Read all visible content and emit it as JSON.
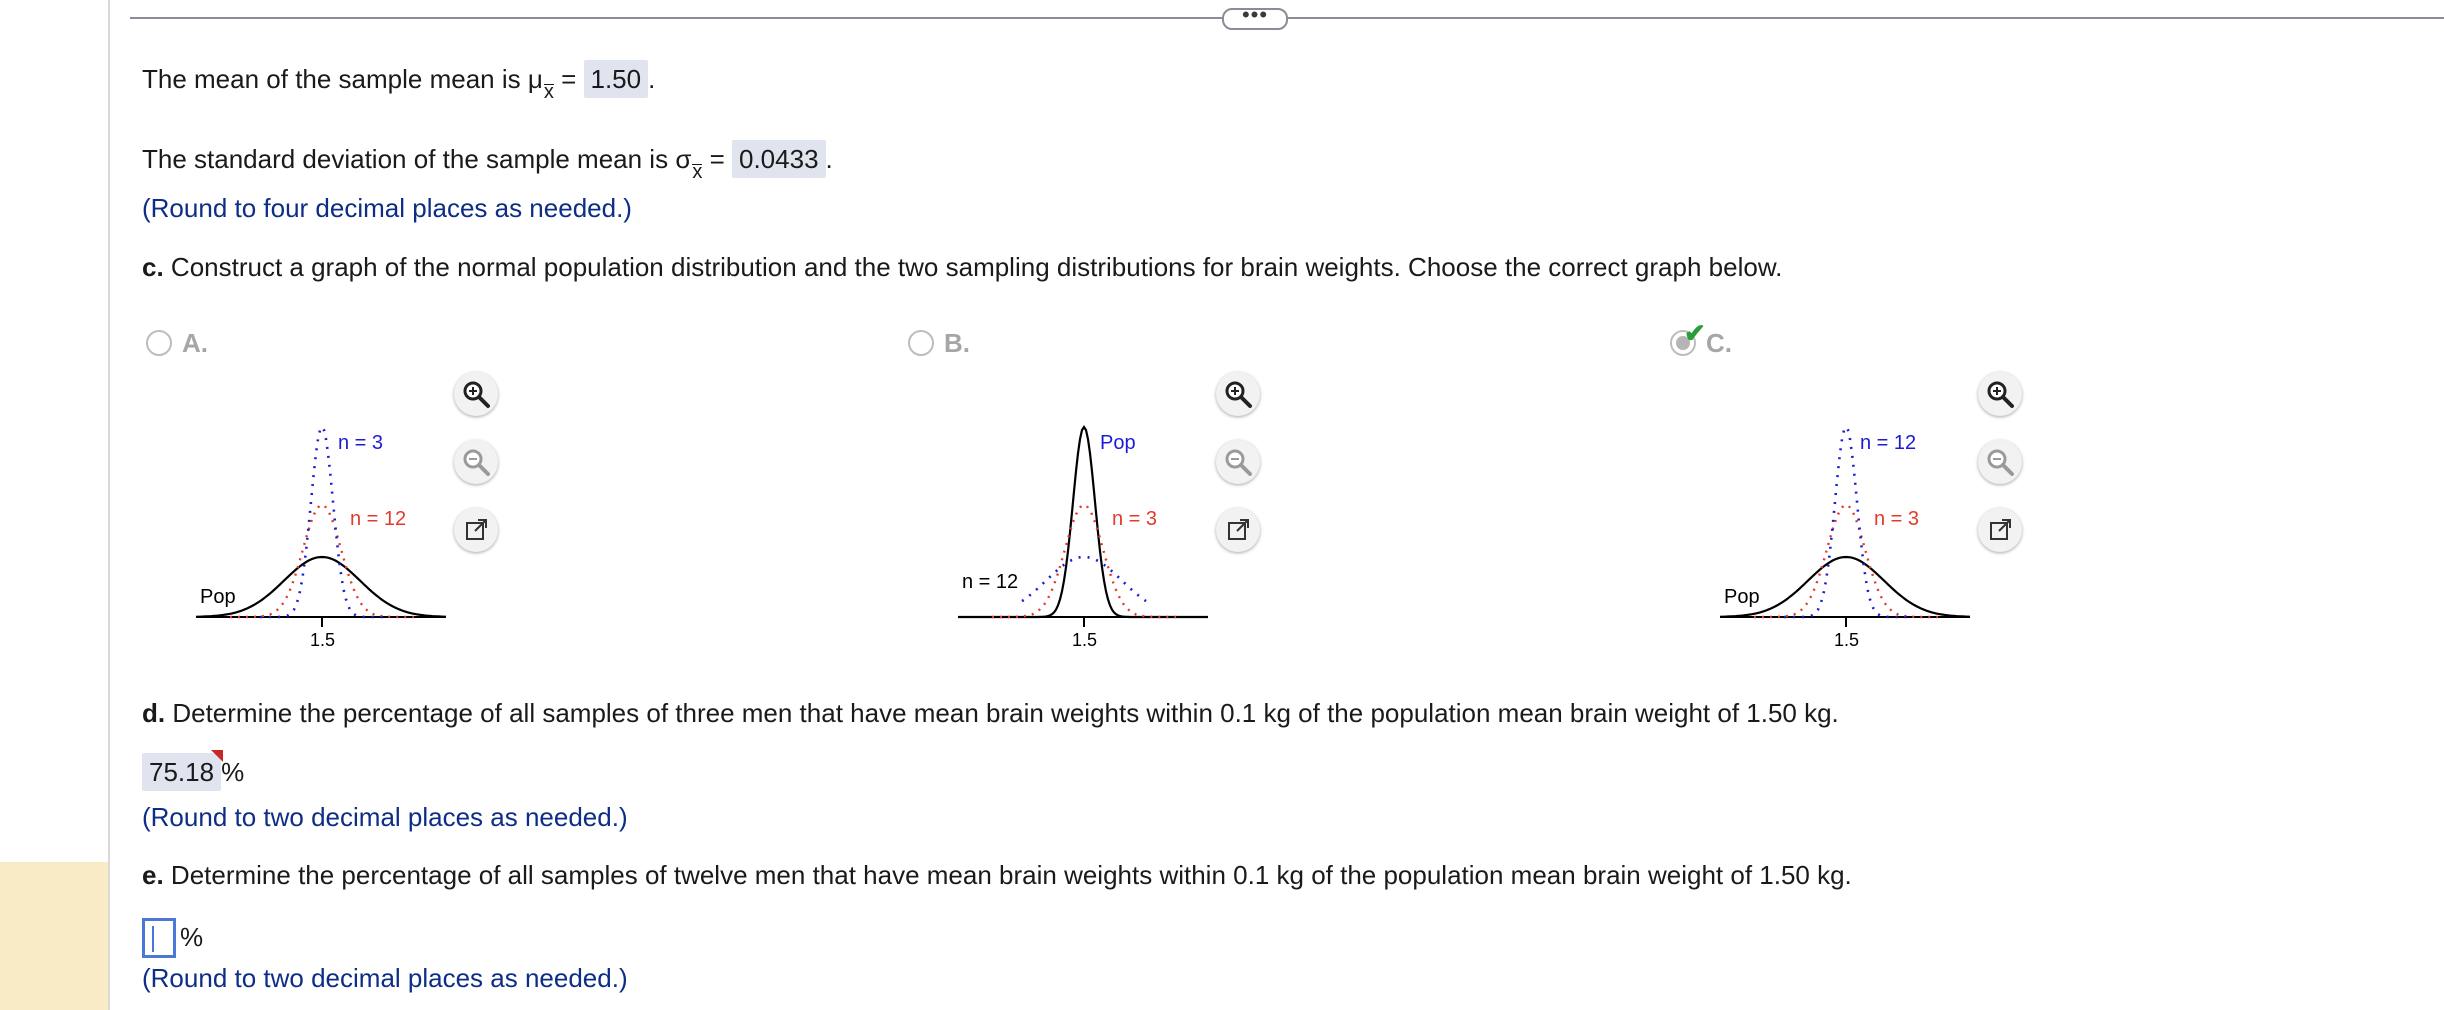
{
  "q_mean": {
    "prefix": "The mean of the sample mean is ",
    "mu": "μ",
    "sub": "x",
    "eq": " = ",
    "value": "1.50",
    "end": "."
  },
  "q_sd": {
    "prefix": "The standard deviation of the sample mean is ",
    "sigma": "σ",
    "sub": "x",
    "eq": " = ",
    "value": "0.0433",
    "end": "."
  },
  "hint_four": "(Round to four decimal places as needed.)",
  "part_c": {
    "label": "c.",
    "text": " Construct a graph of the normal population distribution and the two sampling distributions for brain weights. Choose the correct graph below."
  },
  "options": [
    {
      "label": "A.",
      "selected": false,
      "tall": "n = 3",
      "mid": "n = 12",
      "wide": "Pop",
      "tick": "1.5"
    },
    {
      "label": "B.",
      "selected": false,
      "tall": "Pop",
      "mid": "n = 3",
      "wide": "n = 12",
      "tick": "1.5"
    },
    {
      "label": "C.",
      "selected": true,
      "tall": "n = 12",
      "mid": "n = 3",
      "wide": "Pop",
      "tick": "1.5"
    }
  ],
  "colors": {
    "tall_curve": "#1c1cd4",
    "mid_curve": "#e23a2c",
    "wide_curve": "#000000",
    "hint": "#0d2d86",
    "answer_bg": "#dfe4ee"
  },
  "icons": [
    "zoom-in-icon",
    "zoom-out-icon",
    "popout-icon"
  ],
  "part_d": {
    "label": "d.",
    "text": " Determine the percentage of all samples of three men that have mean brain weights within 0.1 kg of the population mean brain weight of 1.50 kg."
  },
  "answer_d": {
    "value": "75.18",
    "unit": "%"
  },
  "hint_two": "(Round to two decimal places as needed.)",
  "part_e": {
    "label": "e.",
    "text": " Determine the percentage of all samples of twelve men that have mean brain weights within 0.1 kg of the population mean brain weight of 1.50 kg."
  },
  "answer_e": {
    "value": "",
    "unit": "%"
  },
  "hint_two_e": "(Round to two decimal places as needed.)",
  "more_label": "•••"
}
